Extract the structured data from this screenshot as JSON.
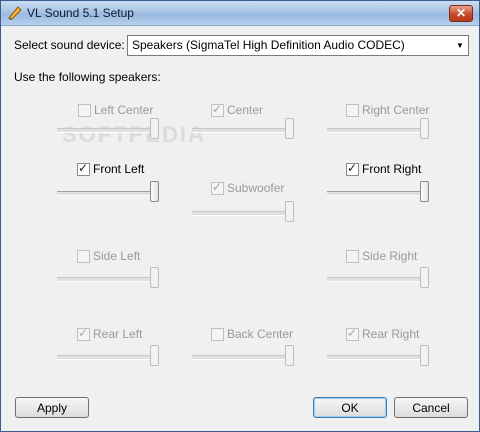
{
  "window": {
    "title": "VL Sound 5.1 Setup",
    "close_label": "✕"
  },
  "device": {
    "label": "Select sound device:",
    "selected": "Speakers (SigmaTel High Definition Audio CODEC)"
  },
  "speakers_label": "Use the following speakers:",
  "speakers": {
    "left_center": {
      "label": "Left Center",
      "checked": false,
      "enabled": false
    },
    "center": {
      "label": "Center",
      "checked": true,
      "enabled": false
    },
    "right_center": {
      "label": "Right Center",
      "checked": false,
      "enabled": false
    },
    "front_left": {
      "label": "Front Left",
      "checked": true,
      "enabled": true
    },
    "subwoofer": {
      "label": "Subwoofer",
      "checked": true,
      "enabled": false
    },
    "front_right": {
      "label": "Front Right",
      "checked": true,
      "enabled": true
    },
    "side_left": {
      "label": "Side Left",
      "checked": false,
      "enabled": false
    },
    "side_right": {
      "label": "Side Right",
      "checked": false,
      "enabled": false
    },
    "rear_left": {
      "label": "Rear Left",
      "checked": true,
      "enabled": false
    },
    "back_center": {
      "label": "Back Center",
      "checked": false,
      "enabled": false
    },
    "rear_right": {
      "label": "Rear Right",
      "checked": true,
      "enabled": false
    }
  },
  "buttons": {
    "apply": "Apply",
    "ok": "OK",
    "cancel": "Cancel"
  }
}
